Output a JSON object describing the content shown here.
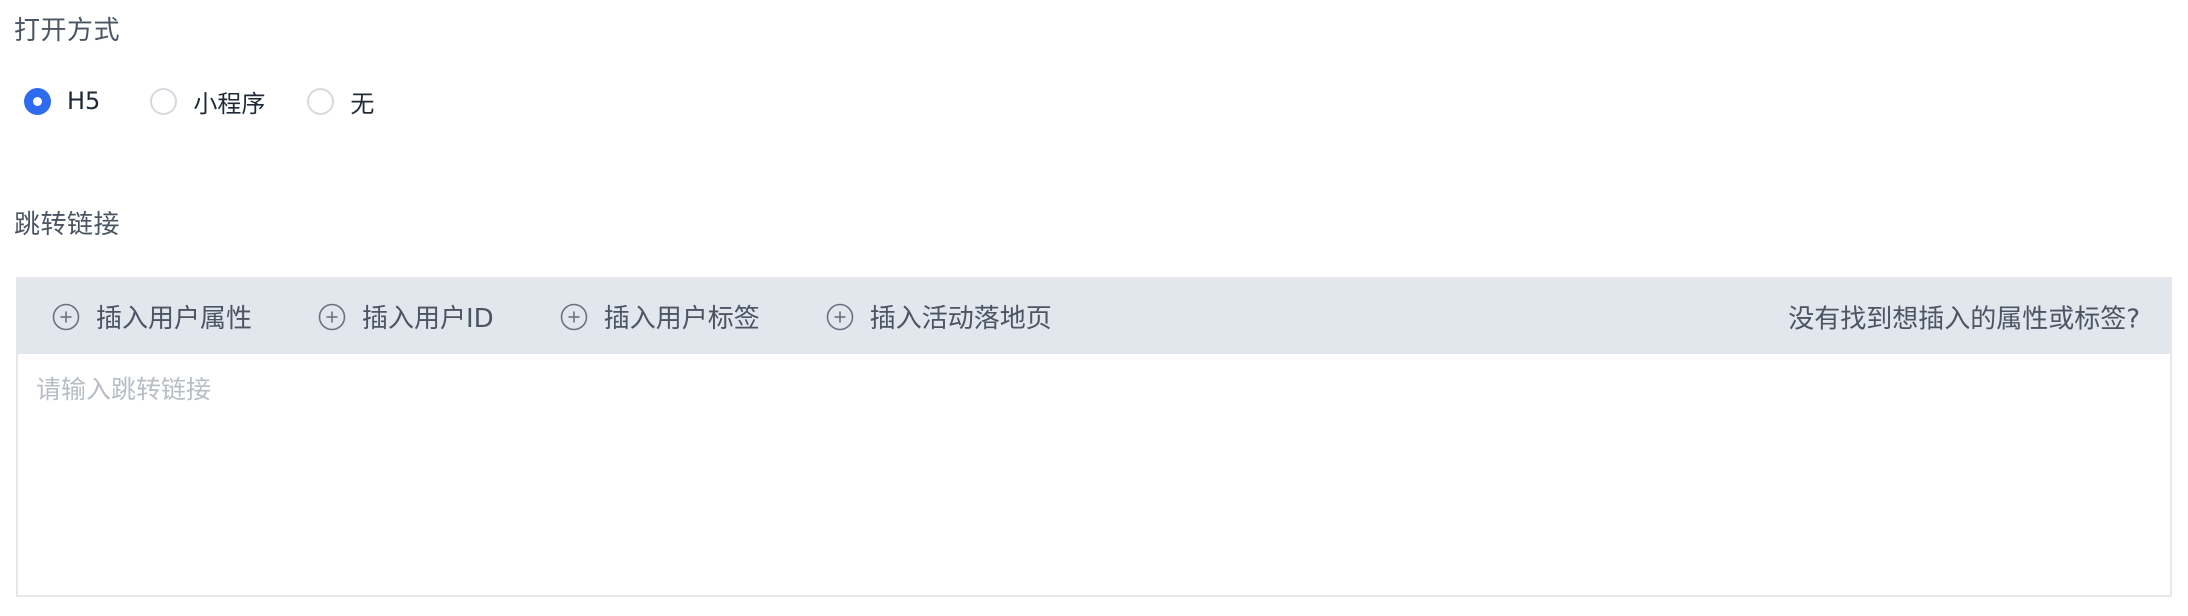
{
  "open_mode": {
    "label": "打开方式",
    "options": [
      {
        "label": "H5",
        "checked": true
      },
      {
        "label": "小程序",
        "checked": false
      },
      {
        "label": "无",
        "checked": false
      }
    ],
    "accent_color": "#2f6bf0"
  },
  "jump_link": {
    "label": "跳转链接",
    "toolbar": {
      "items": [
        {
          "label": "插入用户属性",
          "icon": "plus-circle-icon"
        },
        {
          "label": "插入用户ID",
          "icon": "plus-circle-icon"
        },
        {
          "label": "插入用户标签",
          "icon": "plus-circle-icon"
        },
        {
          "label": "插入活动落地页",
          "icon": "plus-circle-icon"
        }
      ],
      "help_text": "没有找到想插入的属性或标签?"
    },
    "input": {
      "value": "",
      "placeholder": "请输入跳转链接"
    }
  }
}
